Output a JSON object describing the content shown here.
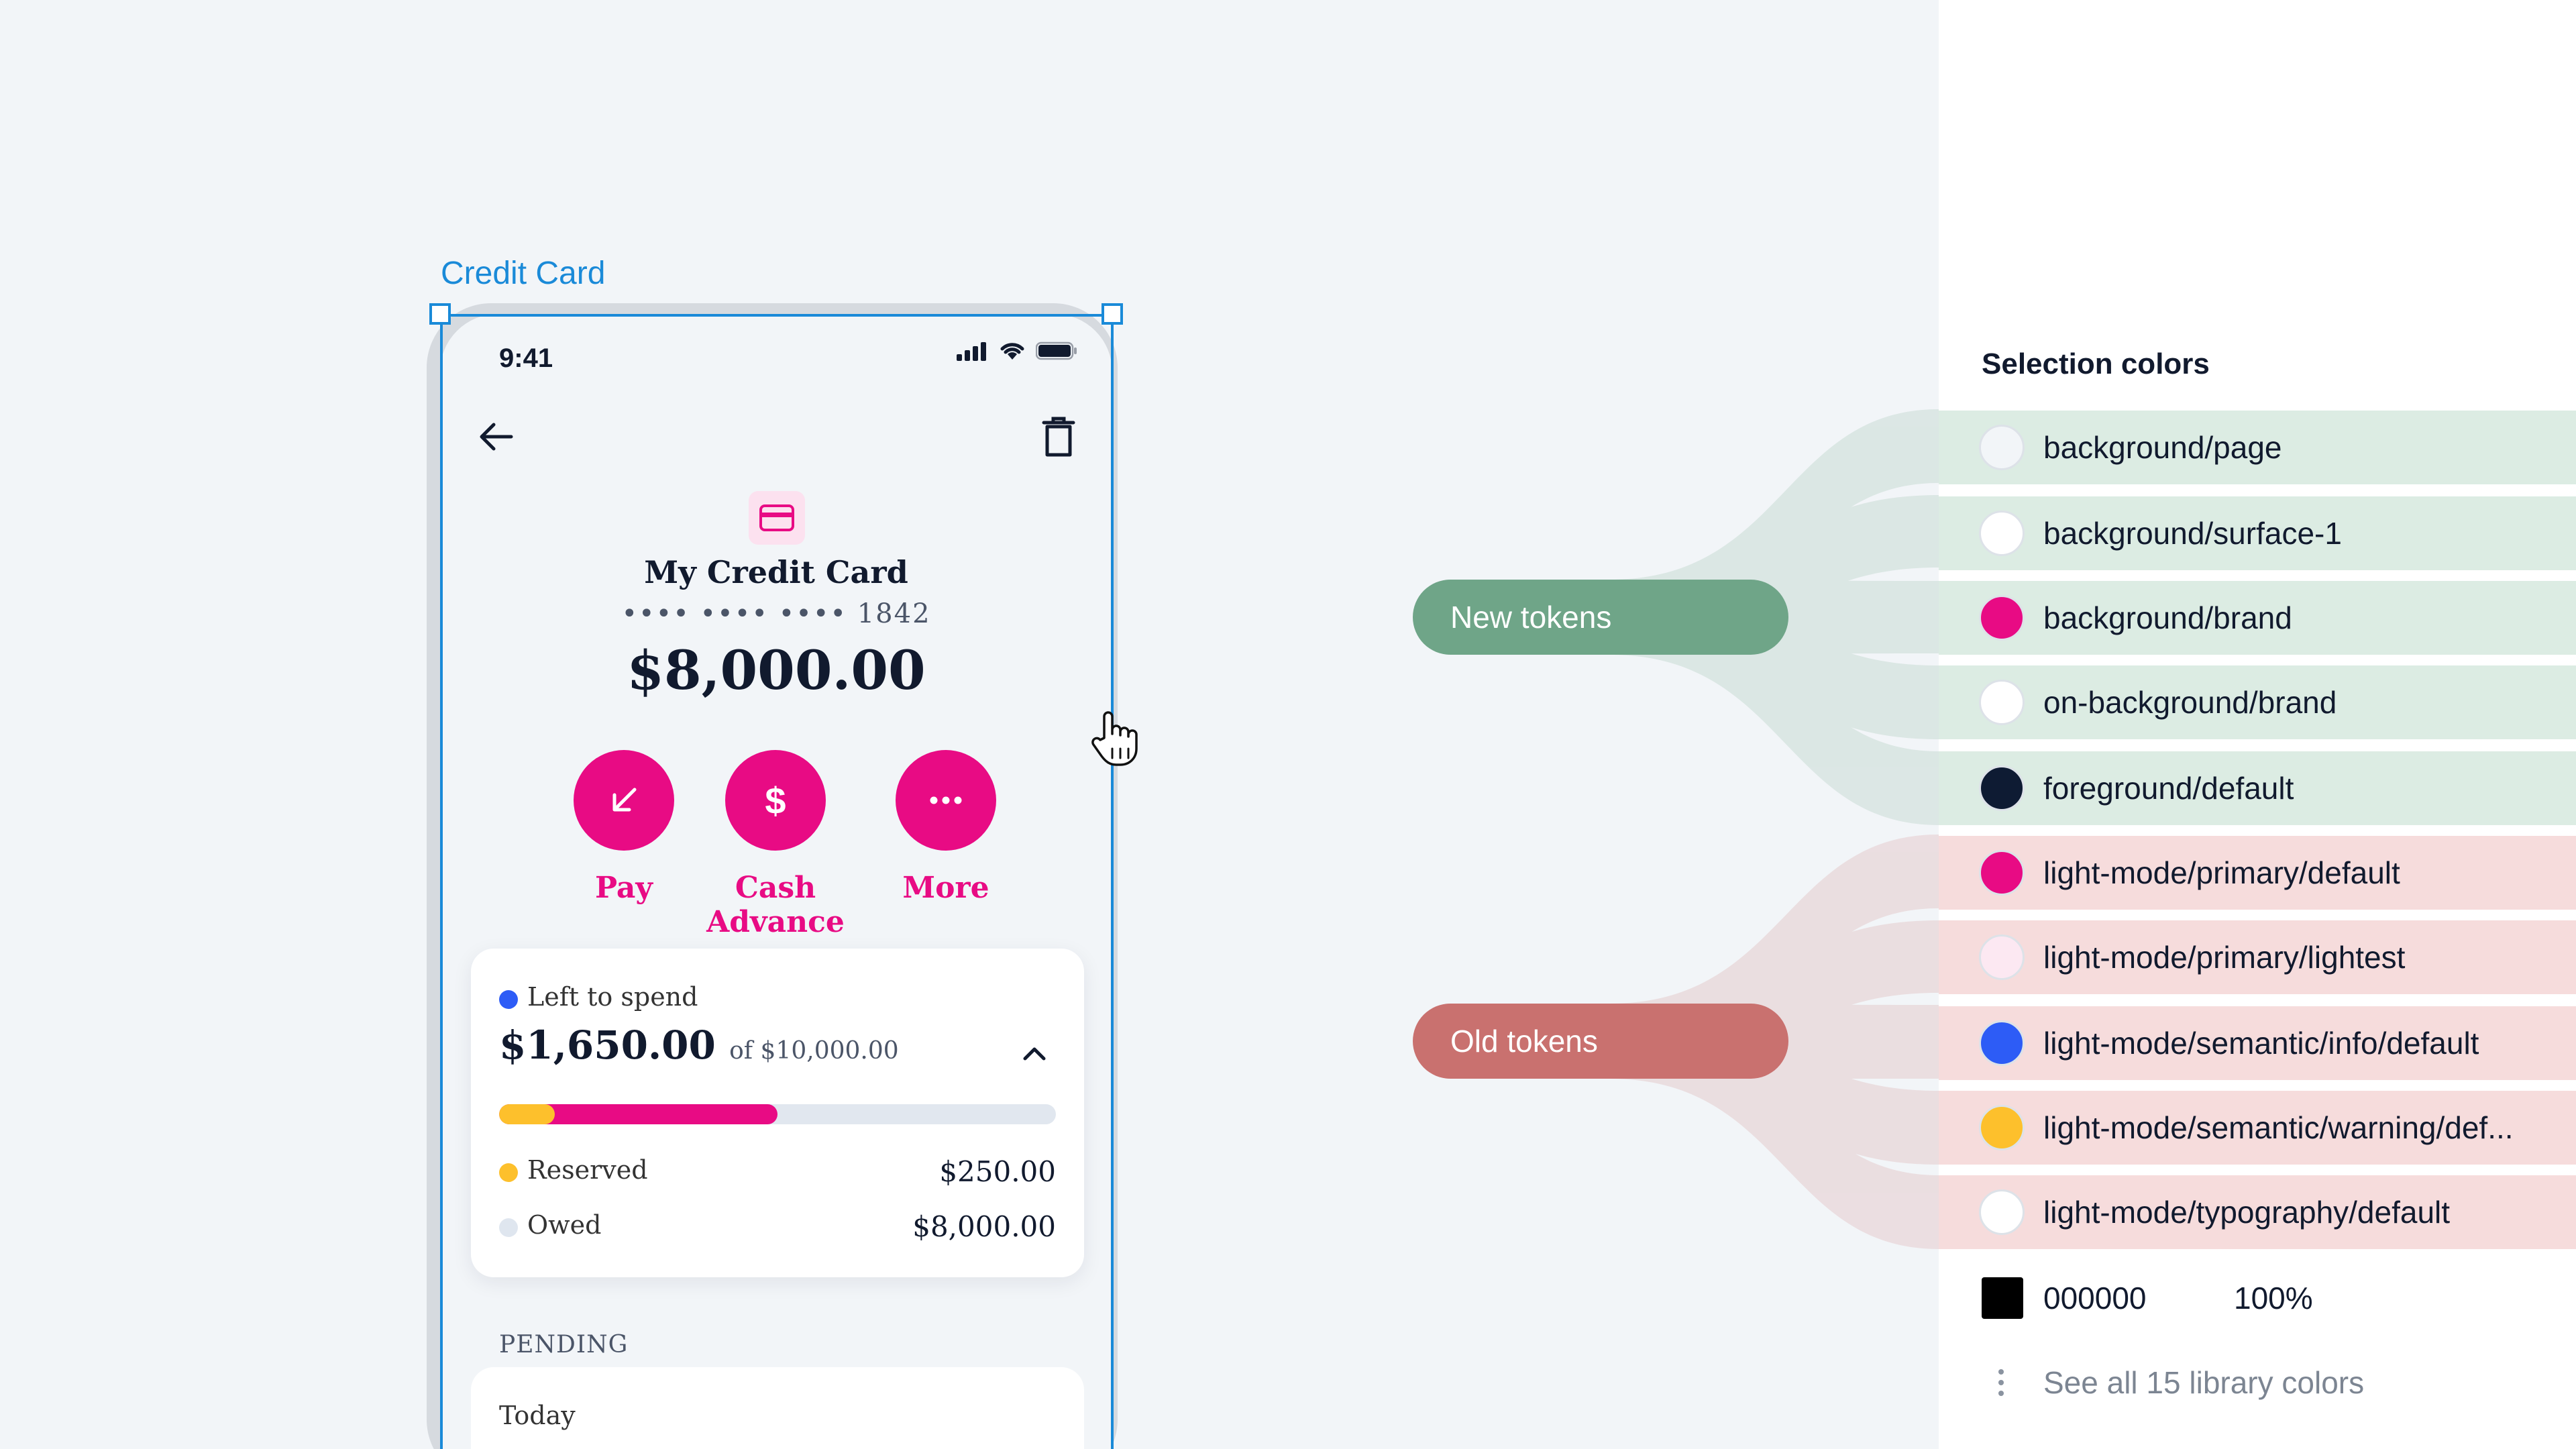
{
  "frame": {
    "label": "Credit Card"
  },
  "phone": {
    "time": "9:41",
    "card_title": "My Credit Card",
    "card_number": "•••• •••• •••• 1842",
    "balance": "$8,000.00",
    "actions": [
      {
        "label": "Pay",
        "icon": "arrow-down-left-icon"
      },
      {
        "label": "Cash Advance",
        "icon": "dollar-icon"
      },
      {
        "label": "More",
        "icon": "more-dots-icon"
      }
    ],
    "spend": {
      "label": "Left to spend",
      "amount": "$1,650.00",
      "of_total": "of $10,000.00",
      "reserved_label": "Reserved",
      "reserved_value": "$250.00",
      "owed_label": "Owed",
      "owed_value": "$8,000.00",
      "progress_used_fraction": 0.5,
      "progress_reserved_fraction": 0.1
    },
    "pending_header": "PENDING",
    "today_label": "Today"
  },
  "flow": {
    "new_label": "New tokens",
    "old_label": "Old tokens"
  },
  "panel": {
    "title": "Selection colors",
    "colors": [
      {
        "name": "background/page",
        "swatch": "#f2f5f8",
        "group": "new"
      },
      {
        "name": "background/surface-1",
        "swatch": "#ffffff",
        "group": "new"
      },
      {
        "name": "background/brand",
        "swatch": "#e80b84",
        "group": "new"
      },
      {
        "name": "on-background/brand",
        "swatch": "#ffffff",
        "group": "new"
      },
      {
        "name": "foreground/default",
        "swatch": "#0e1b33",
        "group": "new"
      },
      {
        "name": "light-mode/primary/default",
        "swatch": "#e80b84",
        "group": "old"
      },
      {
        "name": "light-mode/primary/lightest",
        "swatch": "#fce8f2",
        "group": "old"
      },
      {
        "name": "light-mode/semantic/info/default",
        "swatch": "#2d5cf6",
        "group": "old"
      },
      {
        "name": "light-mode/semantic/warning/def...",
        "swatch": "#fdc02c",
        "group": "old"
      },
      {
        "name": "light-mode/typography/default",
        "swatch": "#ffffff",
        "group": "old"
      }
    ],
    "hex_value": "000000",
    "opacity": "100%",
    "see_all": "See all 15 library colors"
  },
  "colors": {
    "brand": "#e80b84",
    "selection": "#1a8ad8",
    "new_tokens": "#6fa588",
    "old_tokens": "#c9716f"
  }
}
